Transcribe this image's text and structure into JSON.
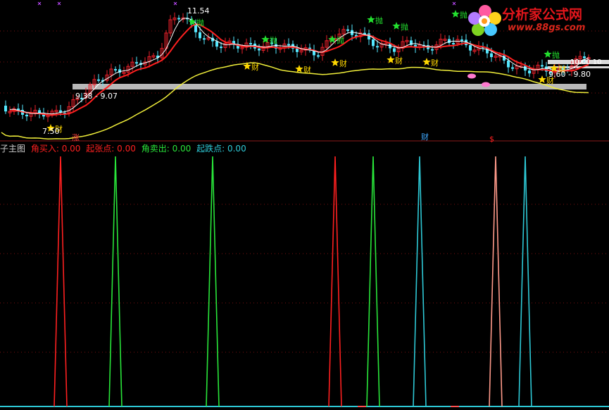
{
  "colors": {
    "background": "#000000",
    "up_candle": "#e8202a",
    "down_candle": "#54e8ff",
    "ma_red": "#ff2020",
    "ma_white": "#ffffff",
    "ma_yellow": "#f0ee3a",
    "band": "#b8b8b8",
    "red": "#ff2020",
    "green": "#29e63a",
    "cyan": "#2ec9d6",
    "salmon": "#ff9a8a",
    "yellow_star": "#ffd800",
    "green_star": "#23e02f"
  },
  "main_chart": {
    "price_labels": {
      "high": "11.54",
      "band_left": "9.38 - 9.07",
      "low": "7.50",
      "band_right": "9.60 - 9.80",
      "right_edge": "10.00 10"
    },
    "signals": {
      "cai": "财",
      "pao": "抛",
      "zhang": "涨",
      "dollar": "$"
    }
  },
  "indicator": {
    "name": "子主图",
    "legend": [
      {
        "label": "角买入:",
        "value": "0.00",
        "color": "#ff2020"
      },
      {
        "label": "起张点:",
        "value": "0.00",
        "color": "#ff2020"
      },
      {
        "label": "角卖出:",
        "value": "0.00",
        "color": "#29e63a"
      },
      {
        "label": "起跌点:",
        "value": "0.00",
        "color": "#2ec9d6"
      }
    ]
  },
  "chart_data": {
    "type": "line",
    "title": "",
    "series": [
      {
        "name": "角买入",
        "color": "#ff2020",
        "peaks_at_candle": [
          14,
          79
        ]
      },
      {
        "name": "角卖出",
        "color": "#29e63a",
        "peaks_at_candle": [
          27,
          50,
          88
        ]
      },
      {
        "name": "起跌点",
        "color": "#2ec9d6",
        "peaks_at_candle": [
          99,
          124
        ]
      },
      {
        "name": "起张点",
        "color": "#ff9a8a",
        "peaks_at_candle": [
          117
        ]
      }
    ],
    "peak_value": 1,
    "ylim": [
      0,
      1
    ],
    "grid": true
  },
  "watermark": {
    "title": "分析家公式网",
    "url": "www.88gs.com"
  }
}
